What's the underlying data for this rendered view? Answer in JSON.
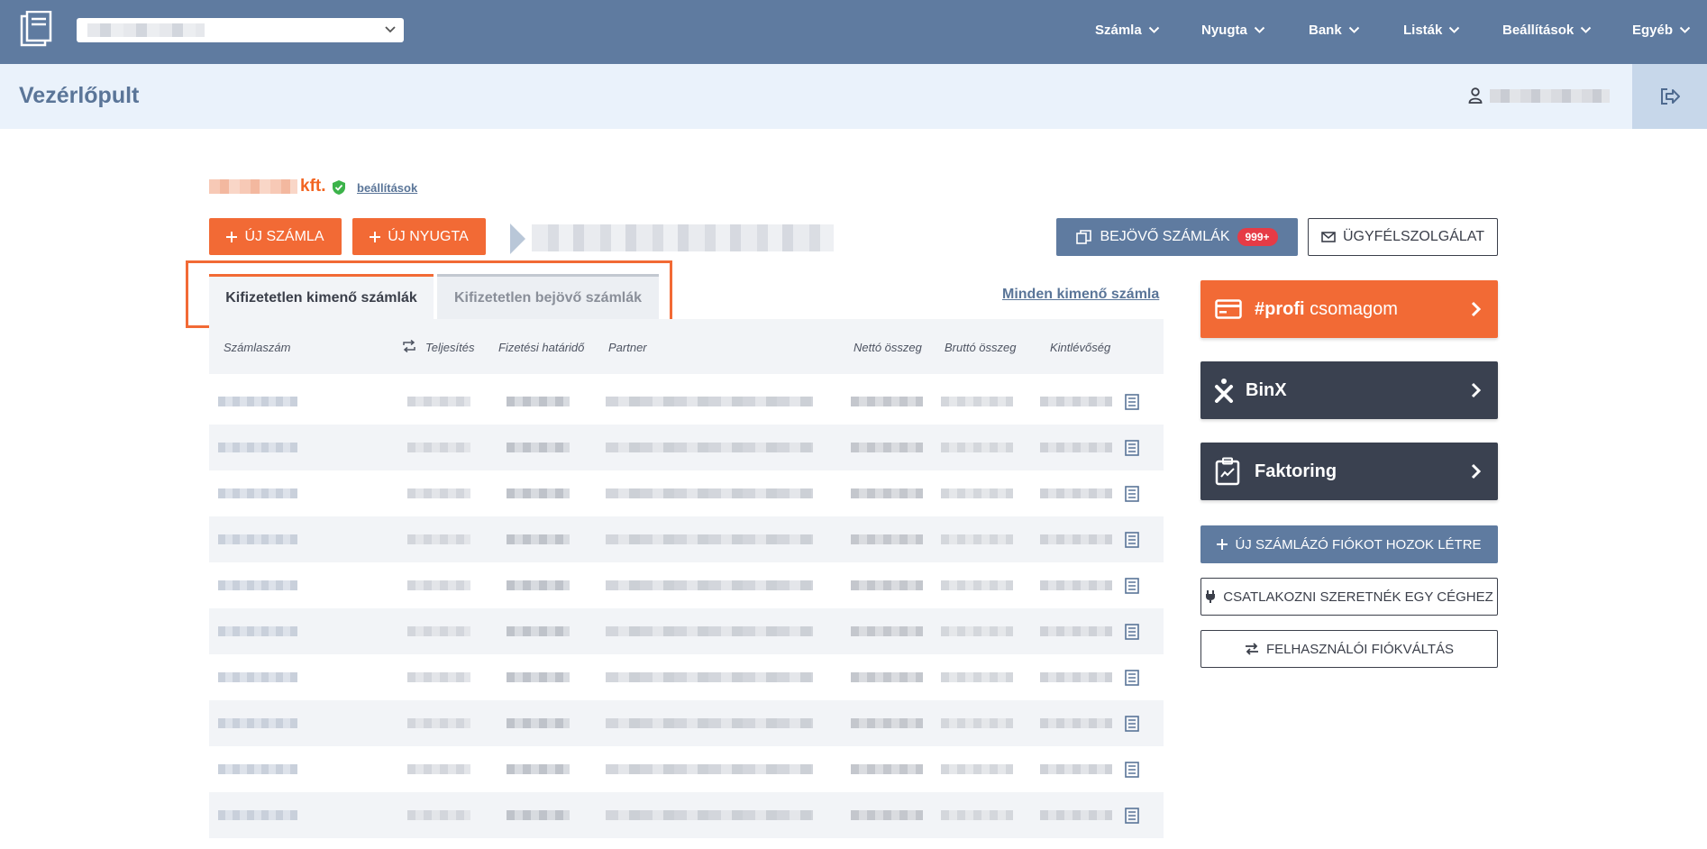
{
  "header": {
    "nav": [
      {
        "label": "Számla"
      },
      {
        "label": "Nyugta"
      },
      {
        "label": "Bank"
      },
      {
        "label": "Listák"
      },
      {
        "label": "Beállítások"
      },
      {
        "label": "Egyéb"
      }
    ]
  },
  "subheader": {
    "title": "Vezérlőpult"
  },
  "company": {
    "suffix": "kft.",
    "settings_link": "beállítások"
  },
  "actions": {
    "new_invoice": "ÚJ SZÁMLA",
    "new_receipt": "ÚJ NYUGTA",
    "incoming_invoices": "BEJÖVŐ SZÁMLÁK",
    "incoming_badge": "999+",
    "support": "ÜGYFÉLSZOLGÁLAT"
  },
  "tabs": [
    {
      "label": "Kifizetetlen kimenő számlák",
      "active": true
    },
    {
      "label": "Kifizetetlen bejövő számlák",
      "active": false
    }
  ],
  "all_outgoing_link": "Minden kimenő számla",
  "table": {
    "columns": [
      "Számlaszám",
      "Teljesítés",
      "Fizetési határidő",
      "Partner",
      "Nettó összeg",
      "Bruttó összeg",
      "Kintlévőség"
    ],
    "row_count": 10
  },
  "sidebar": {
    "profi_bold": "#profi",
    "profi_rest": " csomagom",
    "binx": "BinX",
    "faktoring": "Faktoring",
    "new_account": "ÚJ SZÁMLÁZÓ FIÓKOT HOZOK LÉTRE",
    "join_company": "CSATLAKOZNI SZERETNÉK EGY CÉGHEZ",
    "switch_account": "FELHASZNÁLÓI FIÓKVÁLTÁS"
  },
  "colors": {
    "topbar": "#5f7ba0",
    "accent_orange": "#f26a35",
    "dark_card": "#3a4150",
    "badge_red": "#e63b46"
  }
}
